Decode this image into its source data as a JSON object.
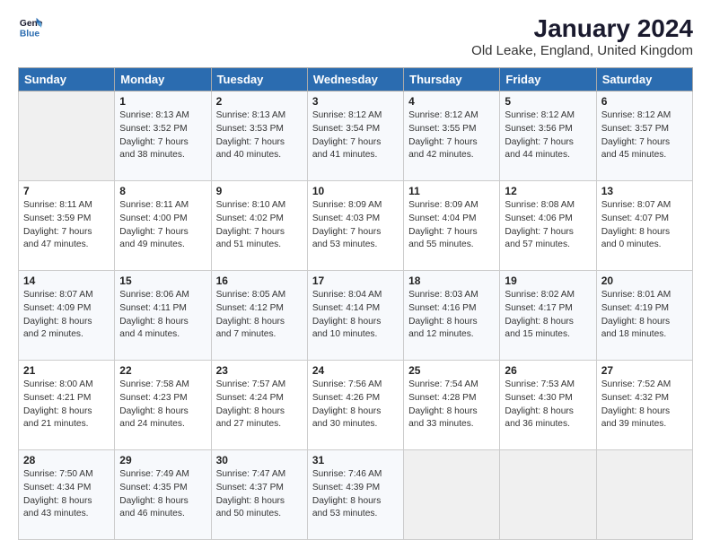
{
  "logo": {
    "line1": "General",
    "line2": "Blue"
  },
  "title": "January 2024",
  "subtitle": "Old Leake, England, United Kingdom",
  "headers": [
    "Sunday",
    "Monday",
    "Tuesday",
    "Wednesday",
    "Thursday",
    "Friday",
    "Saturday"
  ],
  "weeks": [
    [
      {
        "day": "",
        "text": ""
      },
      {
        "day": "1",
        "text": "Sunrise: 8:13 AM\nSunset: 3:52 PM\nDaylight: 7 hours\nand 38 minutes."
      },
      {
        "day": "2",
        "text": "Sunrise: 8:13 AM\nSunset: 3:53 PM\nDaylight: 7 hours\nand 40 minutes."
      },
      {
        "day": "3",
        "text": "Sunrise: 8:12 AM\nSunset: 3:54 PM\nDaylight: 7 hours\nand 41 minutes."
      },
      {
        "day": "4",
        "text": "Sunrise: 8:12 AM\nSunset: 3:55 PM\nDaylight: 7 hours\nand 42 minutes."
      },
      {
        "day": "5",
        "text": "Sunrise: 8:12 AM\nSunset: 3:56 PM\nDaylight: 7 hours\nand 44 minutes."
      },
      {
        "day": "6",
        "text": "Sunrise: 8:12 AM\nSunset: 3:57 PM\nDaylight: 7 hours\nand 45 minutes."
      }
    ],
    [
      {
        "day": "7",
        "text": "Sunrise: 8:11 AM\nSunset: 3:59 PM\nDaylight: 7 hours\nand 47 minutes."
      },
      {
        "day": "8",
        "text": "Sunrise: 8:11 AM\nSunset: 4:00 PM\nDaylight: 7 hours\nand 49 minutes."
      },
      {
        "day": "9",
        "text": "Sunrise: 8:10 AM\nSunset: 4:02 PM\nDaylight: 7 hours\nand 51 minutes."
      },
      {
        "day": "10",
        "text": "Sunrise: 8:09 AM\nSunset: 4:03 PM\nDaylight: 7 hours\nand 53 minutes."
      },
      {
        "day": "11",
        "text": "Sunrise: 8:09 AM\nSunset: 4:04 PM\nDaylight: 7 hours\nand 55 minutes."
      },
      {
        "day": "12",
        "text": "Sunrise: 8:08 AM\nSunset: 4:06 PM\nDaylight: 7 hours\nand 57 minutes."
      },
      {
        "day": "13",
        "text": "Sunrise: 8:07 AM\nSunset: 4:07 PM\nDaylight: 8 hours\nand 0 minutes."
      }
    ],
    [
      {
        "day": "14",
        "text": "Sunrise: 8:07 AM\nSunset: 4:09 PM\nDaylight: 8 hours\nand 2 minutes."
      },
      {
        "day": "15",
        "text": "Sunrise: 8:06 AM\nSunset: 4:11 PM\nDaylight: 8 hours\nand 4 minutes."
      },
      {
        "day": "16",
        "text": "Sunrise: 8:05 AM\nSunset: 4:12 PM\nDaylight: 8 hours\nand 7 minutes."
      },
      {
        "day": "17",
        "text": "Sunrise: 8:04 AM\nSunset: 4:14 PM\nDaylight: 8 hours\nand 10 minutes."
      },
      {
        "day": "18",
        "text": "Sunrise: 8:03 AM\nSunset: 4:16 PM\nDaylight: 8 hours\nand 12 minutes."
      },
      {
        "day": "19",
        "text": "Sunrise: 8:02 AM\nSunset: 4:17 PM\nDaylight: 8 hours\nand 15 minutes."
      },
      {
        "day": "20",
        "text": "Sunrise: 8:01 AM\nSunset: 4:19 PM\nDaylight: 8 hours\nand 18 minutes."
      }
    ],
    [
      {
        "day": "21",
        "text": "Sunrise: 8:00 AM\nSunset: 4:21 PM\nDaylight: 8 hours\nand 21 minutes."
      },
      {
        "day": "22",
        "text": "Sunrise: 7:58 AM\nSunset: 4:23 PM\nDaylight: 8 hours\nand 24 minutes."
      },
      {
        "day": "23",
        "text": "Sunrise: 7:57 AM\nSunset: 4:24 PM\nDaylight: 8 hours\nand 27 minutes."
      },
      {
        "day": "24",
        "text": "Sunrise: 7:56 AM\nSunset: 4:26 PM\nDaylight: 8 hours\nand 30 minutes."
      },
      {
        "day": "25",
        "text": "Sunrise: 7:54 AM\nSunset: 4:28 PM\nDaylight: 8 hours\nand 33 minutes."
      },
      {
        "day": "26",
        "text": "Sunrise: 7:53 AM\nSunset: 4:30 PM\nDaylight: 8 hours\nand 36 minutes."
      },
      {
        "day": "27",
        "text": "Sunrise: 7:52 AM\nSunset: 4:32 PM\nDaylight: 8 hours\nand 39 minutes."
      }
    ],
    [
      {
        "day": "28",
        "text": "Sunrise: 7:50 AM\nSunset: 4:34 PM\nDaylight: 8 hours\nand 43 minutes."
      },
      {
        "day": "29",
        "text": "Sunrise: 7:49 AM\nSunset: 4:35 PM\nDaylight: 8 hours\nand 46 minutes."
      },
      {
        "day": "30",
        "text": "Sunrise: 7:47 AM\nSunset: 4:37 PM\nDaylight: 8 hours\nand 50 minutes."
      },
      {
        "day": "31",
        "text": "Sunrise: 7:46 AM\nSunset: 4:39 PM\nDaylight: 8 hours\nand 53 minutes."
      },
      {
        "day": "",
        "text": ""
      },
      {
        "day": "",
        "text": ""
      },
      {
        "day": "",
        "text": ""
      }
    ]
  ]
}
